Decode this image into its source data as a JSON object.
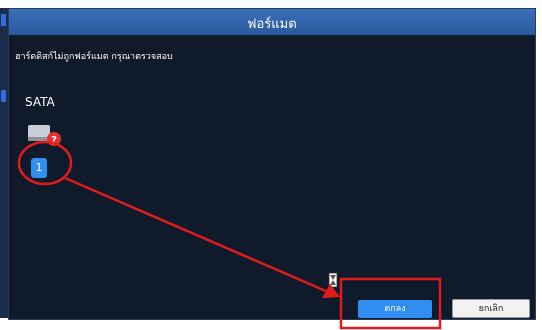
{
  "dialog": {
    "title": "ฟอร์แมต",
    "message": "ฮาร์ดดิสก์ไม่ถูกฟอร์แมต กรุณาตรวจสอบ"
  },
  "disk": {
    "group_label": "SATA",
    "icon": "hard-disk-question-icon",
    "number": "1"
  },
  "buttons": {
    "ok_label": "ตกลง",
    "cancel_label": "ยกเลิก"
  },
  "colors": {
    "accent": "#2f8ef0",
    "title_bar": "#3b6fb8",
    "dialog_bg": "#0f1a2b",
    "annotation": "#e11b1b"
  }
}
